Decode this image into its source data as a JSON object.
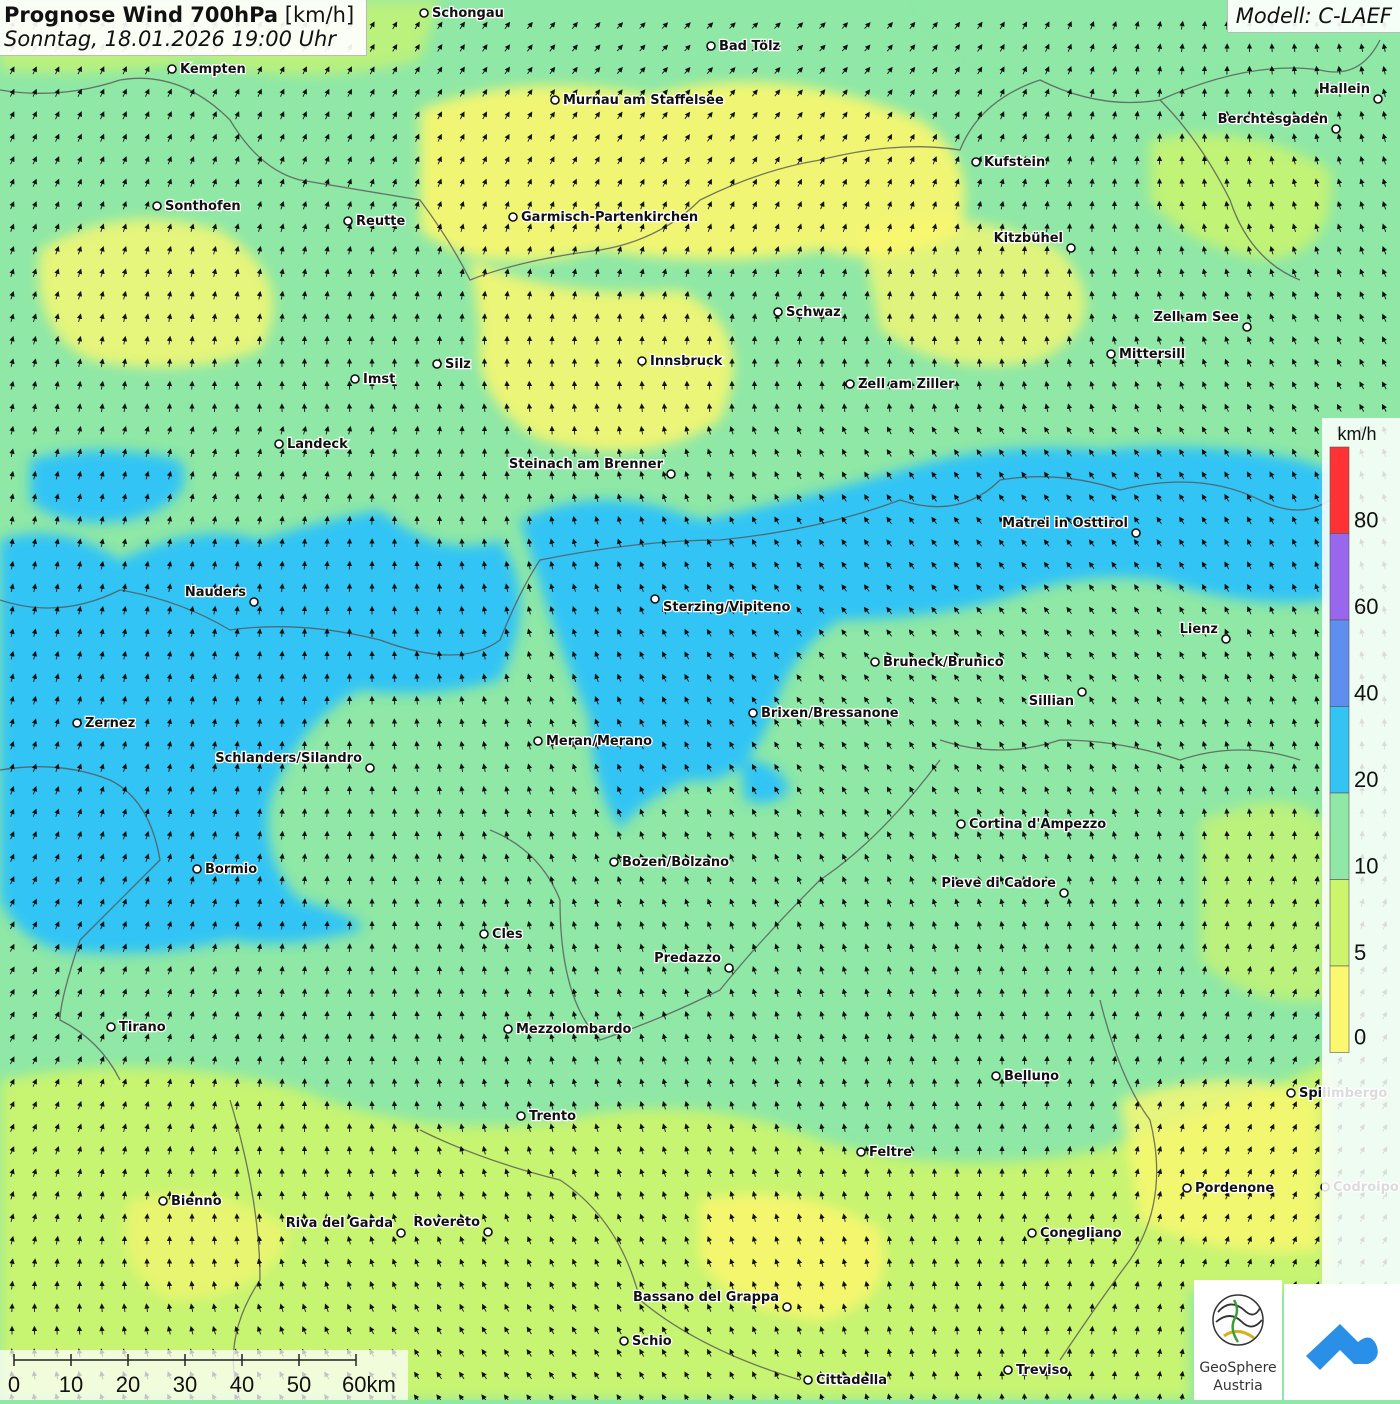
{
  "header": {
    "title_bold": "Prognose Wind 700hPa",
    "title_unit": "[km/h]",
    "datetime": "Sonntag, 18.01.2026 19:00 Uhr",
    "model": "Modell: C-LAEF"
  },
  "legend": {
    "unit": "km/h",
    "labels": [
      "80",
      "60",
      "40",
      "20",
      "10",
      "5",
      "0"
    ],
    "colors": [
      "#ff3333",
      "#9966ee",
      "#5f8fee",
      "#33c4f4",
      "#8fe8a6",
      "#cdf56c",
      "#fbf76f"
    ]
  },
  "scale_bar": {
    "labels": [
      "0",
      "10",
      "20",
      "30",
      "40",
      "50",
      "60km"
    ]
  },
  "cities": [
    {
      "name": "Schongau"
    },
    {
      "name": "Bad Tölz"
    },
    {
      "name": "Kempten"
    },
    {
      "name": "Murnau am Staffelsee"
    },
    {
      "name": "Hallein"
    },
    {
      "name": "Berchtesgaden"
    },
    {
      "name": "Kufstein"
    },
    {
      "name": "Sonthofen"
    },
    {
      "name": "Reutte"
    },
    {
      "name": "Garmisch-Partenkirchen"
    },
    {
      "name": "Kitzbühel"
    },
    {
      "name": "Schwaz"
    },
    {
      "name": "Zell am See"
    },
    {
      "name": "Innsbruck"
    },
    {
      "name": "Mittersill"
    },
    {
      "name": "Silz"
    },
    {
      "name": "Imst"
    },
    {
      "name": "Zell am Ziller"
    },
    {
      "name": "Landeck"
    },
    {
      "name": "Steinach am Brenner"
    },
    {
      "name": "Matrei in Osttirol"
    },
    {
      "name": "Nauders"
    },
    {
      "name": "Sterzing/Vipiteno"
    },
    {
      "name": "Lienz"
    },
    {
      "name": "Bruneck/Brunico"
    },
    {
      "name": "Sillian"
    },
    {
      "name": "Brixen/Bressanone"
    },
    {
      "name": "Zernez"
    },
    {
      "name": "Meran/Merano"
    },
    {
      "name": "Schlanders/Silandro"
    },
    {
      "name": "Cortina d'Ampezzo"
    },
    {
      "name": "Bozen/Bolzano"
    },
    {
      "name": "Bormio"
    },
    {
      "name": "Pieve di Cadore"
    },
    {
      "name": "Cles"
    },
    {
      "name": "Predazzo"
    },
    {
      "name": "Tirano"
    },
    {
      "name": "Mezzolombardo"
    },
    {
      "name": "Belluno"
    },
    {
      "name": "Spilimbergo"
    },
    {
      "name": "Trento"
    },
    {
      "name": "Feltre"
    },
    {
      "name": "Pordenone"
    },
    {
      "name": "Codroipo"
    },
    {
      "name": "Bienno"
    },
    {
      "name": "Riva del Garda"
    },
    {
      "name": "Rovereto"
    },
    {
      "name": "Conegliano"
    },
    {
      "name": "Bassano del Grappa"
    },
    {
      "name": "Schio"
    },
    {
      "name": "Treviso"
    },
    {
      "name": "Cittadella"
    }
  ],
  "logos": {
    "geosphere_line1": "GeoSphere",
    "geosphere_line2": "Austria"
  }
}
